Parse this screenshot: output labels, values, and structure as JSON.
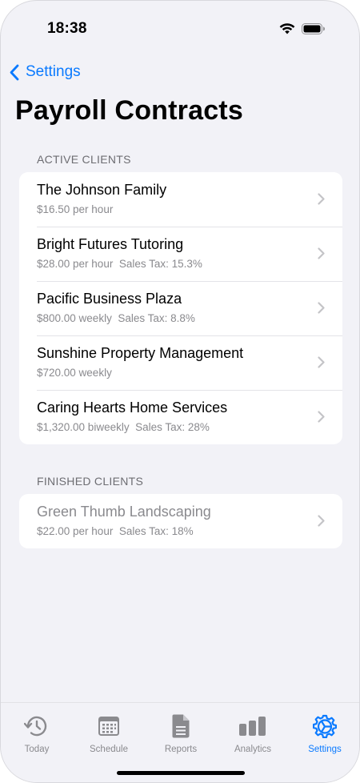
{
  "status": {
    "time": "18:38"
  },
  "nav": {
    "back_label": "Settings"
  },
  "page": {
    "title": "Payroll Contracts"
  },
  "sections": {
    "active": {
      "header": "ACTIVE CLIENTS",
      "items": [
        {
          "name": "The Johnson Family",
          "rate": "$16.50 per hour",
          "tax": ""
        },
        {
          "name": "Bright Futures Tutoring",
          "rate": "$28.00 per hour",
          "tax": "Sales Tax: 15.3%"
        },
        {
          "name": "Pacific Business Plaza",
          "rate": "$800.00 weekly",
          "tax": "Sales Tax: 8.8%"
        },
        {
          "name": "Sunshine Property Management",
          "rate": "$720.00 weekly",
          "tax": ""
        },
        {
          "name": "Caring Hearts Home Services",
          "rate": "$1,320.00 biweekly",
          "tax": "Sales Tax: 28%"
        }
      ]
    },
    "finished": {
      "header": "FINISHED CLIENTS",
      "items": [
        {
          "name": "Green Thumb Landscaping",
          "rate": "$22.00 per hour",
          "tax": "Sales Tax: 18%"
        }
      ]
    }
  },
  "tabs": [
    {
      "label": "Today",
      "icon": "clock-history-icon",
      "active": false
    },
    {
      "label": "Schedule",
      "icon": "calendar-icon",
      "active": false
    },
    {
      "label": "Reports",
      "icon": "document-icon",
      "active": false
    },
    {
      "label": "Analytics",
      "icon": "bar-chart-icon",
      "active": false
    },
    {
      "label": "Settings",
      "icon": "gear-icon",
      "active": true
    }
  ],
  "colors": {
    "accent": "#0a7aff",
    "background": "#f2f2f7",
    "secondary_text": "#8a8a8e"
  }
}
